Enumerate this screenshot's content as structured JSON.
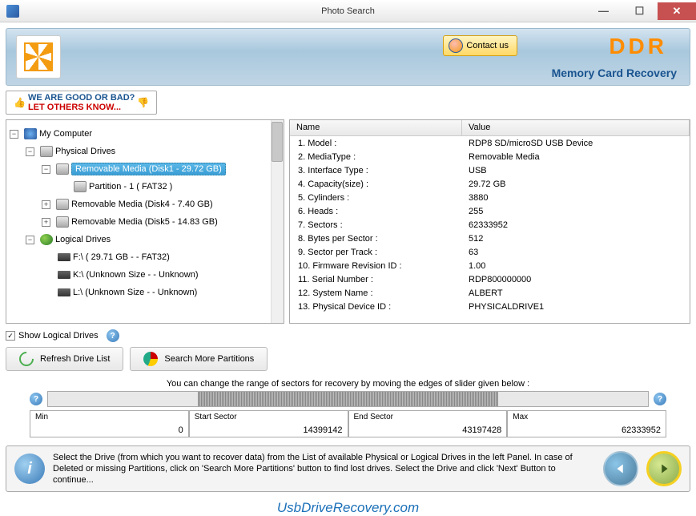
{
  "window": {
    "title": "Photo Search"
  },
  "banner": {
    "contact": "Contact us",
    "brand": "DDR",
    "tagline": "Memory Card Recovery"
  },
  "goodbad": {
    "line1": "WE ARE GOOD OR BAD?",
    "line2": "LET OTHERS KNOW..."
  },
  "tree": {
    "root": "My Computer",
    "physical": "Physical Drives",
    "disk1": "Removable Media (Disk1 - 29.72 GB)",
    "partition1": "Partition - 1 ( FAT32 )",
    "disk4": "Removable Media (Disk4 - 7.40 GB)",
    "disk5": "Removable Media (Disk5 - 14.83 GB)",
    "logical": "Logical Drives",
    "f": "F:\\ ( 29.71 GB  -  - FAT32)",
    "k": "K:\\ (Unknown Size  -  - Unknown)",
    "l": "L:\\ (Unknown Size  -  - Unknown)"
  },
  "detail": {
    "headers": {
      "name": "Name",
      "value": "Value"
    },
    "rows": [
      {
        "n": "1. Model :",
        "v": "RDP8 SD/microSD USB Device"
      },
      {
        "n": "2. MediaType :",
        "v": "Removable Media"
      },
      {
        "n": "3. Interface Type :",
        "v": "USB"
      },
      {
        "n": "4. Capacity(size) :",
        "v": "29.72 GB"
      },
      {
        "n": "5. Cylinders :",
        "v": "3880"
      },
      {
        "n": "6. Heads :",
        "v": "255"
      },
      {
        "n": "7. Sectors :",
        "v": "62333952"
      },
      {
        "n": "8. Bytes per Sector :",
        "v": "512"
      },
      {
        "n": "9. Sector per Track :",
        "v": "63"
      },
      {
        "n": "10. Firmware Revision ID :",
        "v": "1.00"
      },
      {
        "n": "11. Serial Number :",
        "v": "RDP800000000"
      },
      {
        "n": "12. System Name :",
        "v": "ALBERT"
      },
      {
        "n": "13. Physical Device ID :",
        "v": "PHYSICALDRIVE1"
      }
    ]
  },
  "showLogical": "Show Logical Drives",
  "buttons": {
    "refresh": "Refresh Drive List",
    "search": "Search More Partitions"
  },
  "slider": {
    "caption": "You can change the range of sectors for recovery by moving the edges of slider given below :",
    "min": {
      "label": "Min",
      "value": "0"
    },
    "start": {
      "label": "Start Sector",
      "value": "14399142"
    },
    "end": {
      "label": "End Sector",
      "value": "43197428"
    },
    "max": {
      "label": "Max",
      "value": "62333952"
    }
  },
  "footer": {
    "text": "Select the Drive (from which you want to recover data) from the List of available Physical or Logical Drives in the left Panel. In case of Deleted or missing Partitions, click on 'Search More Partitions' button to find lost drives. Select the Drive and click 'Next' Button to continue..."
  },
  "watermark": "UsbDriveRecovery.com"
}
